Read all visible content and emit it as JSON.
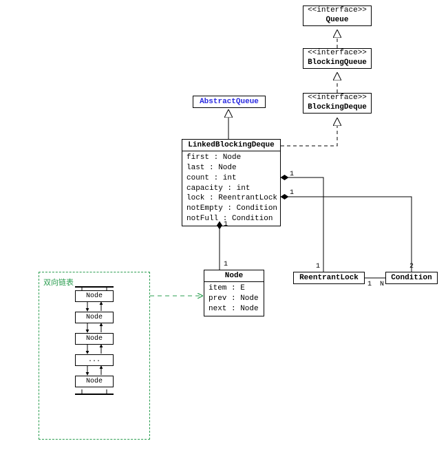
{
  "interfaces": {
    "stereotype": "<<interface>>",
    "queue": "Queue",
    "blockingQueue": "BlockingQueue",
    "blockingDeque": "BlockingDeque"
  },
  "abstractQueue": "AbstractQueue",
  "lbd": {
    "name": "LinkedBlockingDeque",
    "attrs": "first : Node\nlast : Node\ncount : int\ncapacity : int\nlock : ReentrantLock\nnotEmpty : Condition\nnotFull : Condition"
  },
  "node": {
    "name": "Node",
    "attrs": "item : E\nprev : Node\nnext : Node"
  },
  "reentrantLock": "ReentrantLock",
  "condition": "Condition",
  "mult": {
    "lbdNode_a": "1",
    "lbdNode_b": "1",
    "lbdLock_a": "1",
    "lbdLock_b": "1",
    "lbdCond_a": "1",
    "lbdCond_b": "2",
    "lockCond_a": "1",
    "lockCond_b": "N"
  },
  "greenPanel": {
    "title": "双向链表",
    "rows": [
      "Node",
      "Node",
      "Node",
      "...",
      "Node"
    ]
  }
}
